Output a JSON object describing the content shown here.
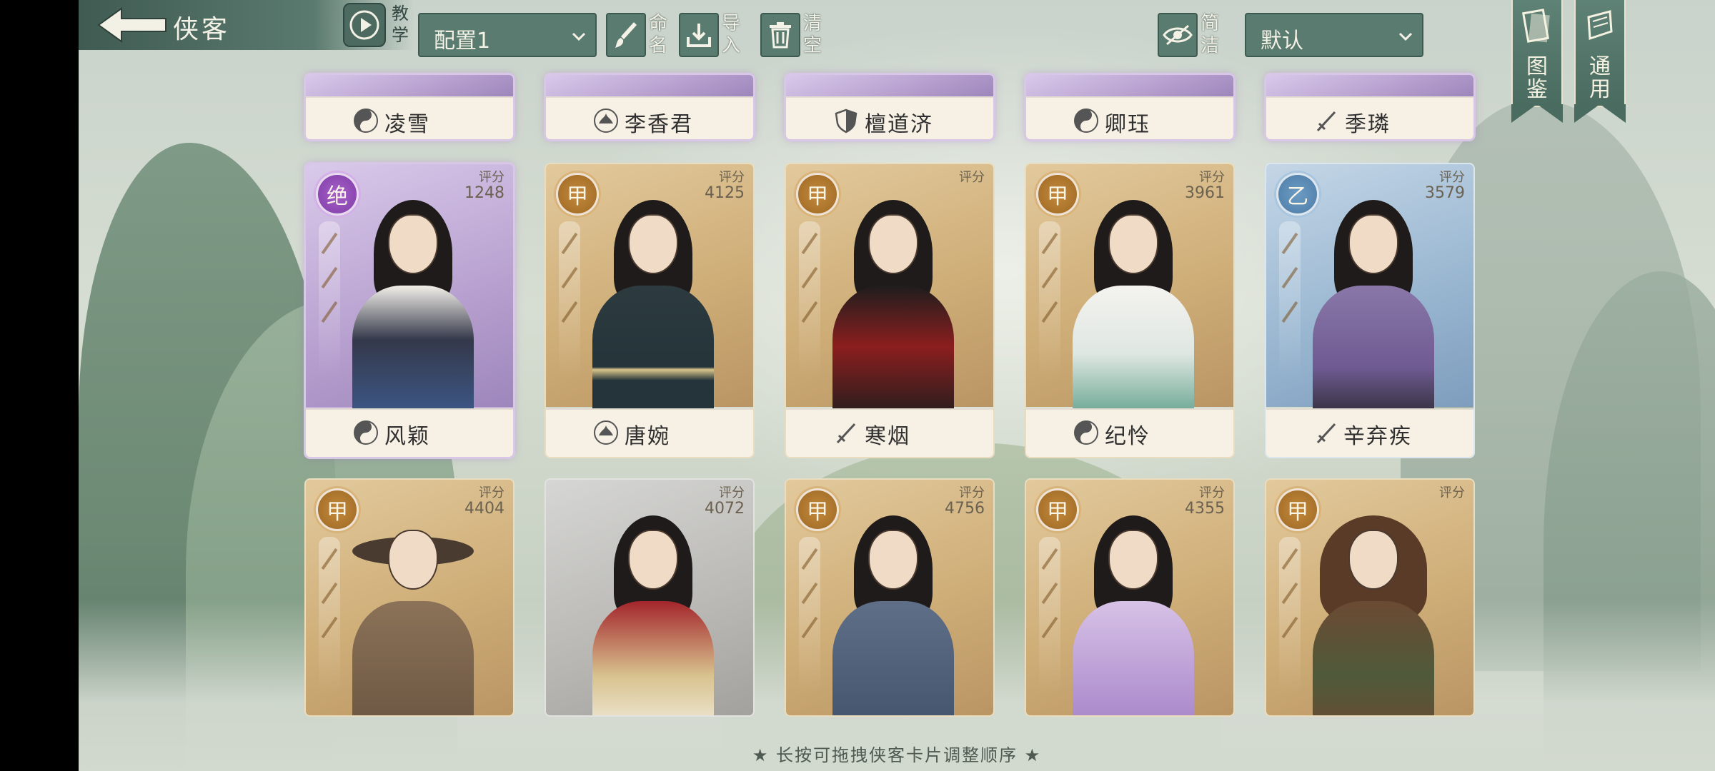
{
  "header": {
    "title": "侠客",
    "tutorial_label": "教学",
    "config_select_value": "配置1",
    "rename_label": "命名",
    "import_label": "导入",
    "clear_label": "清空",
    "simple_label": "简洁",
    "sort_select_value": "默认",
    "encyclopedia_label": "图鉴",
    "general_label": "通用"
  },
  "score_label": "评分",
  "top_row": [
    {
      "name": "凌雪",
      "school_icon": "yin-yang-icon",
      "color": "purple"
    },
    {
      "name": "李香君",
      "school_icon": "lotus-icon",
      "color": "purple"
    },
    {
      "name": "檀道济",
      "school_icon": "shield-icon",
      "color": "purple"
    },
    {
      "name": "卿珏",
      "school_icon": "yin-yang-icon",
      "color": "purple"
    },
    {
      "name": "季璘",
      "school_icon": "sword-icon",
      "color": "purple"
    }
  ],
  "middle_row": [
    {
      "name": "风颖",
      "grade": "绝",
      "score": "1248",
      "school_icon": "yin-yang-icon",
      "style": "purple"
    },
    {
      "name": "唐婉",
      "grade": "甲",
      "score": "4125",
      "school_icon": "lotus-icon",
      "style": "gold"
    },
    {
      "name": "寒烟",
      "grade": "甲",
      "score": "",
      "school_icon": "sword-icon",
      "style": "gold"
    },
    {
      "name": "纪怜",
      "grade": "甲",
      "score": "3961",
      "school_icon": "yin-yang-icon",
      "style": "gold"
    },
    {
      "name": "辛弃疾",
      "grade": "乙",
      "score": "3579",
      "school_icon": "sword-icon",
      "style": "blue"
    }
  ],
  "bottom_row": [
    {
      "grade": "甲",
      "score": "4404",
      "style": "gold"
    },
    {
      "grade": "",
      "score": "4072",
      "style": "silver"
    },
    {
      "grade": "甲",
      "score": "4756",
      "style": "gold"
    },
    {
      "grade": "甲",
      "score": "4355",
      "style": "gold"
    },
    {
      "grade": "甲",
      "score": "",
      "style": "gold"
    }
  ],
  "footer_hint": "★ 长按可拖拽侠客卡片调整顺序 ★",
  "colors": {
    "button_bg": "#5a7b6f",
    "button_border": "#3d5a51",
    "grade_jia": "#9d6826",
    "grade_yi": "#4d7ca6",
    "grade_jue": "#7e3ea6",
    "card_purple": "#c7b3d9"
  }
}
